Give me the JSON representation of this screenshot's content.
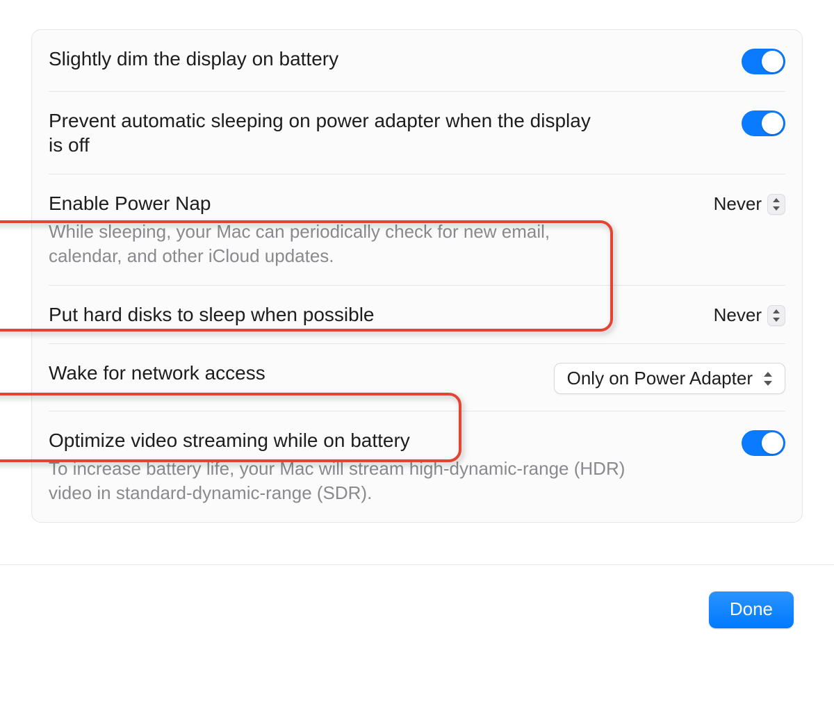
{
  "colors": {
    "accent": "#007aff",
    "highlight": "#e24632"
  },
  "settings": {
    "dim_display": {
      "title": "Slightly dim the display on battery",
      "toggle_on": true
    },
    "prevent_sleep": {
      "title": "Prevent automatic sleeping on power adapter when the display is off",
      "toggle_on": true
    },
    "power_nap": {
      "title": "Enable Power Nap",
      "desc": "While sleeping, your Mac can periodically check for new email, calendar, and other iCloud updates.",
      "value": "Never"
    },
    "hard_disks": {
      "title": "Put hard disks to sleep when possible",
      "value": "Never"
    },
    "wake_network": {
      "title": "Wake for network access",
      "value": "Only on Power Adapter"
    },
    "optimize_video": {
      "title": "Optimize video streaming while on battery",
      "desc": "To increase battery life, your Mac will stream high-dynamic-range (HDR) video in standard-dynamic-range (SDR).",
      "toggle_on": true
    }
  },
  "footer": {
    "done_label": "Done"
  }
}
